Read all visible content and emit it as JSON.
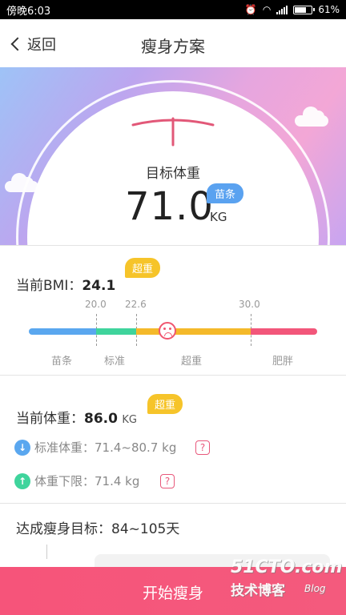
{
  "status_bar": {
    "time": "傍晚6:03",
    "battery": "61%",
    "battery_level": 0.61,
    "icons": [
      "alarm-off-icon",
      "wifi-icon",
      "signal-icon",
      "battery-icon"
    ]
  },
  "nav": {
    "back_label": "返回",
    "title": "瘦身方案"
  },
  "target": {
    "label": "目标体重",
    "value": "71.0",
    "unit": "KG",
    "badge": "苗条"
  },
  "bmi": {
    "label": "当前BMI：",
    "value": "24.1",
    "badge": "超重",
    "thresholds": [
      "20.0",
      "22.6",
      "30.0"
    ],
    "categories": [
      "苗条",
      "标准",
      "超重",
      "肥胖"
    ],
    "colors": [
      "#5aa7ef",
      "#3fd49c",
      "#f4b92a",
      "#f2567a"
    ]
  },
  "weight": {
    "label": "当前体重：",
    "value": "86.0",
    "unit": "KG",
    "badge": "超重",
    "standard_text": "标准体重：71.4~80.7 kg",
    "lower_text": "体重下限：71.4 kg",
    "help_glyph": "?"
  },
  "goal": {
    "text": "达成瘦身目标：84~105天"
  },
  "bottom": {
    "start_label": "开始瘦身"
  },
  "watermark": {
    "line1": "51CTO.com",
    "line2": "技术博客",
    "line3": "Blog"
  },
  "colors": {
    "accent_pink": "#f6547a",
    "accent_blue": "#5aa2f0",
    "accent_yellow": "#f6c42a"
  }
}
